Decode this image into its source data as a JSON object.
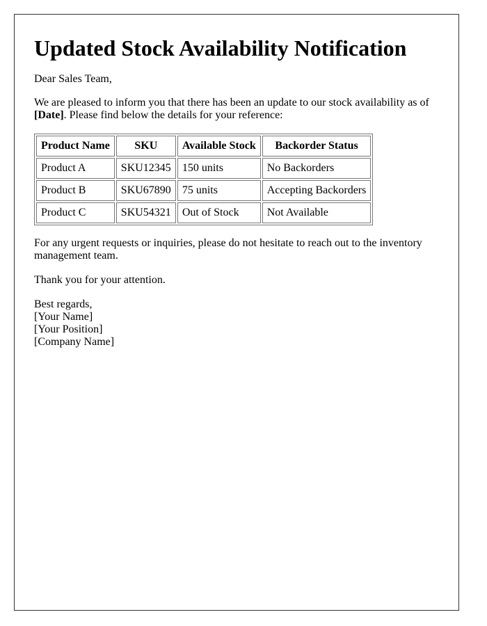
{
  "title": "Updated Stock Availability Notification",
  "greeting": "Dear Sales Team,",
  "intro": {
    "text_before": "We are pleased to inform you that there has been an update to our stock availability as of ",
    "date_placeholder": "[Date]",
    "text_after": ". Please find below the details for your reference:"
  },
  "table": {
    "headers": [
      "Product Name",
      "SKU",
      "Available Stock",
      "Backorder Status"
    ],
    "rows": [
      [
        "Product A",
        "SKU12345",
        "150 units",
        "No Backorders"
      ],
      [
        "Product B",
        "SKU67890",
        "75 units",
        "Accepting Backorders"
      ],
      [
        "Product C",
        "SKU54321",
        "Out of Stock",
        "Not Available"
      ]
    ]
  },
  "followup": "For any urgent requests or inquiries, please do not hesitate to reach out to the inventory management team.",
  "thanks": "Thank you for your attention.",
  "signature": {
    "closing": "Best regards,",
    "name": "[Your Name]",
    "position": "[Your Position]",
    "company": "[Company Name]"
  }
}
